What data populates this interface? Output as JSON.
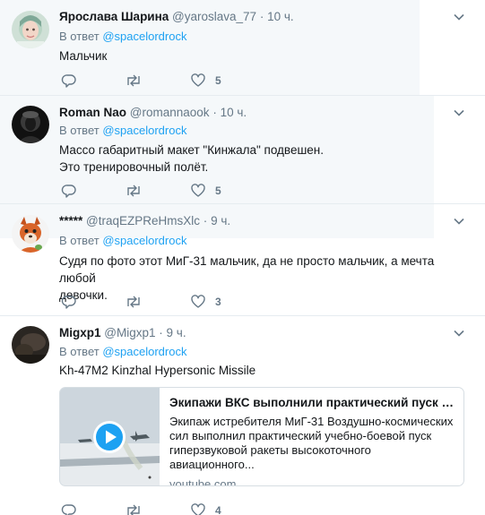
{
  "tweets": [
    {
      "name": "Ярослава Шарина",
      "handle": "@yaroslava_77",
      "time": "10 ч.",
      "reply_prefix": "В ответ",
      "reply_mention": "@spacelordrock",
      "lines": [
        "Мальчик"
      ],
      "likes": "5"
    },
    {
      "name": "Roman Nao",
      "handle": "@romannaook",
      "time": "10 ч.",
      "reply_prefix": "В ответ",
      "reply_mention": "@spacelordrock",
      "lines": [
        "Массо габаритный макет \"Кинжала\" подвешен.",
        "Это тренировочный полёт."
      ],
      "likes": "5"
    },
    {
      "name": "*****",
      "handle": "@traqEZPReHmsXlc",
      "time": "9 ч.",
      "reply_prefix": "В ответ",
      "reply_mention": "@spacelordrock",
      "lines": [
        "Судя по фото этот МиГ-31 мальчик, да не просто мальчик, а мечта любой",
        "девочки."
      ],
      "likes": "3"
    },
    {
      "name": "Migxp1",
      "handle": "@Migxp1",
      "time": "9 ч.",
      "reply_prefix": "В ответ",
      "reply_mention": "@spacelordrock",
      "lines": [
        "Kh-47M2 Kinzhal Hypersonic Missile"
      ],
      "likes": "4",
      "card": {
        "title": "Экипажи ВКС выполнили практический пуск ракеты «Кинжал»",
        "desc_lines": [
          "Экипаж истребителя МиГ-31 Воздушно-космических",
          "сил выполнил практический учебно-боевой пуск",
          "гиперзвуковой ракеты высокоточного авиационного..."
        ],
        "domain": "youtube.com"
      }
    }
  ],
  "separator": "·",
  "icons": {
    "reply": "reply-icon",
    "retweet": "retweet-icon",
    "like": "heart-icon",
    "more": "chevron-down-icon",
    "play": "play-icon"
  },
  "colors": {
    "link": "#1da1f2",
    "muted": "#657786",
    "highlight_bg": "#f5f8fa",
    "play_button": "#1da1f2"
  }
}
